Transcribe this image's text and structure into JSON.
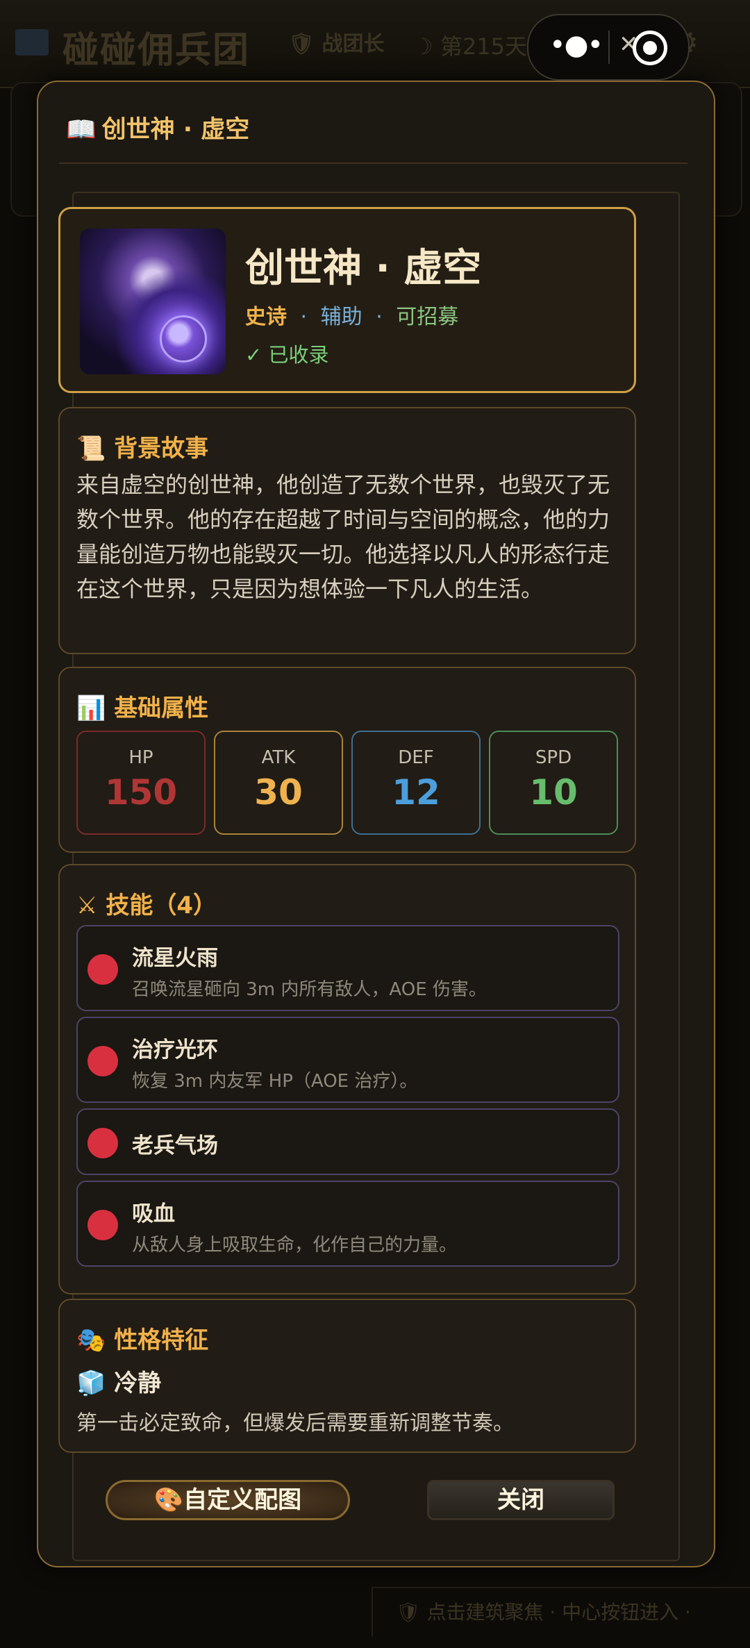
{
  "background": {
    "app_title": "碰碰佣兵团",
    "role": "战团长",
    "day": "第215天 04:00",
    "hint": "点击建筑聚焦 · 中心按钮进入 ·"
  },
  "modal": {
    "title": "创世神 · 虚空",
    "title_icon": "book-icon"
  },
  "hero": {
    "name": "创世神 · 虚空",
    "rarity": "史诗",
    "role": "辅助",
    "recruit": "可招募",
    "separator": "·",
    "collected": "✓ 已收录"
  },
  "story": {
    "title": "背景故事",
    "icon": "scroll-icon",
    "text": "来自虚空的创世神，他创造了无数个世界，也毁灭了无数个世界。他的存在超越了时间与空间的概念，他的力量能创造万物也能毁灭一切。他选择以凡人的形态行走在这个世界，只是因为想体验一下凡人的生活。"
  },
  "attributes": {
    "title": "基础属性",
    "icon": "bar-chart-icon",
    "stats": [
      {
        "label": "HP",
        "value": "150",
        "color": "#b03636"
      },
      {
        "label": "ATK",
        "value": "30",
        "color": "#efb24e"
      },
      {
        "label": "DEF",
        "value": "12",
        "color": "#4c9edb"
      },
      {
        "label": "SPD",
        "value": "10",
        "color": "#67bd6d"
      }
    ]
  },
  "skills": {
    "title": "技能（4）",
    "icon": "crossed-swords-icon",
    "items": [
      {
        "name": "流星火雨",
        "desc": "召唤流星砸向 3m 内所有敌人，AOE 伤害。"
      },
      {
        "name": "治疗光环",
        "desc": "恢复 3m 内友军 HP（AOE 治疗）。"
      },
      {
        "name": "老兵气场",
        "desc": ""
      },
      {
        "name": "吸血",
        "desc": "从敌人身上吸取生命，化作自己的力量。"
      }
    ]
  },
  "trait": {
    "title": "性格特征",
    "icon": "theater-masks-icon",
    "name": "冷静",
    "name_icon": "ice-cube-icon",
    "desc": "第一击必定致命，但爆发后需要重新调整节奏。"
  },
  "buttons": {
    "custom": "自定义配图",
    "custom_icon": "palette-icon",
    "close": "关闭"
  },
  "colors": {
    "accent": "#f2b24a",
    "border_gold": "#cfa047",
    "skill_bullet": "#d93040"
  }
}
